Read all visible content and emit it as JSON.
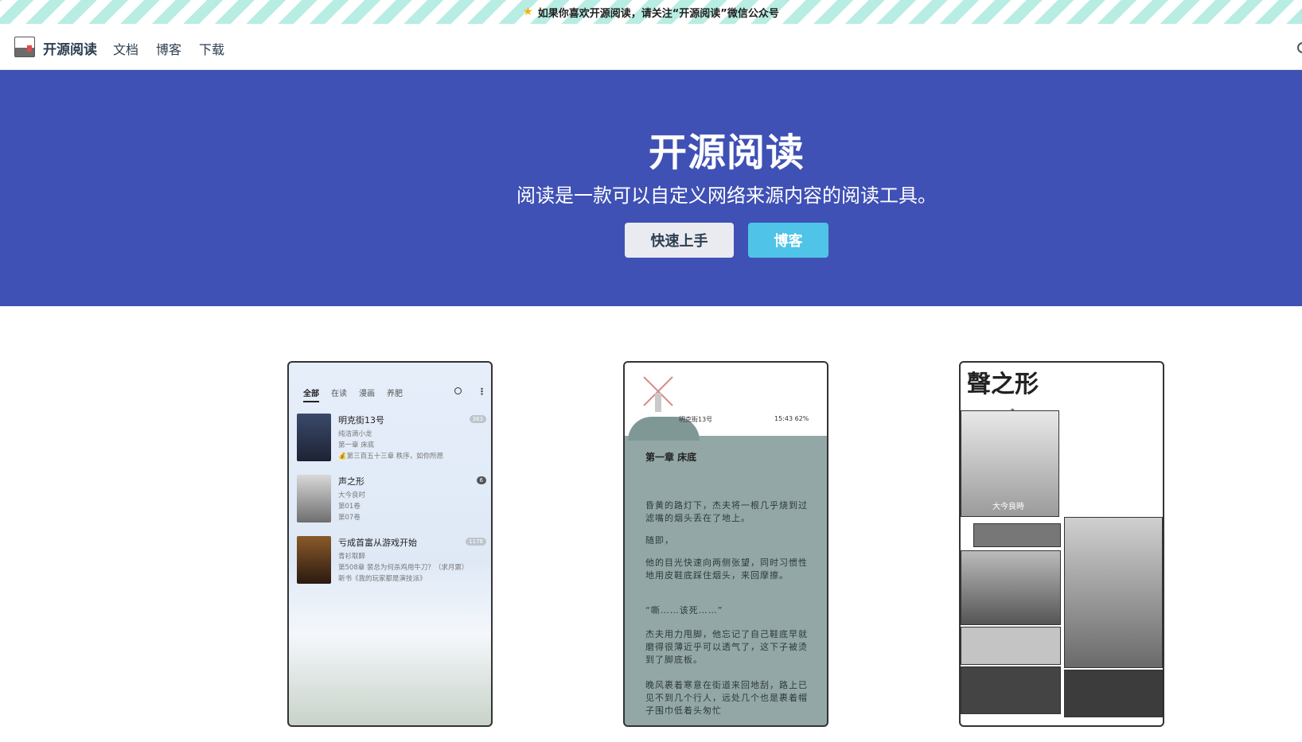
{
  "banner": {
    "text": "如果你喜欢开源阅读，请关注“开源阅读”微信公众号",
    "icon": "star-icon"
  },
  "navbar": {
    "site_name": "开源阅读",
    "links": [
      "文档",
      "博客",
      "下载"
    ]
  },
  "hero": {
    "title": "开源阅读",
    "subtitle": "阅读是一款可以自定义网络来源内容的阅读工具。",
    "buttons": {
      "primary": "快速上手",
      "secondary": "博客"
    },
    "background": "#3f51b5",
    "secondary_color": "#4fc3e8"
  },
  "phone1": {
    "tabs": [
      "全部",
      "在读",
      "漫画",
      "养肥"
    ],
    "books": [
      {
        "title": "明克街13号",
        "author": "纯洁滴小龙",
        "current": "第一章 床底",
        "latest": "💰第三百五十三章 秩序，如你所愿",
        "badge": "363"
      },
      {
        "title": "声之形",
        "author": "大今良时",
        "current": "第01卷",
        "latest": "第07卷",
        "badge": "6"
      },
      {
        "title": "亏成首富从游戏开始",
        "author": "青衫取醉",
        "current": "第508章 裴总为何杀鸡用牛刀？（求月票）",
        "latest": "新书《我的玩家都是演技派》",
        "badge": "1178"
      }
    ]
  },
  "phone2": {
    "status_left": "明克街13号",
    "status_right": "15:43 62%",
    "chapter": "第一章 床底",
    "paragraphs": [
      "昏黄的路灯下，杰夫将一根几乎烧到过滤嘴的烟头丢在了地上。",
      "随即，",
      "他的目光快速向两侧张望，同时习惯性地用皮鞋底踩住烟头，来回摩擦。",
      "“嘶……该死……”",
      "杰夫用力甩脚，他忘记了自己鞋底早就磨得很薄近乎可以透气了，这下子被烫到了脚底板。",
      "晚风裹着寒意在街道来回地刮，路上已见不到几个行人，远处几个也是裹着帽子围巾低着头匆忙"
    ]
  },
  "phone3": {
    "title": "聲之形",
    "volume": "1",
    "author": "大今良時"
  }
}
